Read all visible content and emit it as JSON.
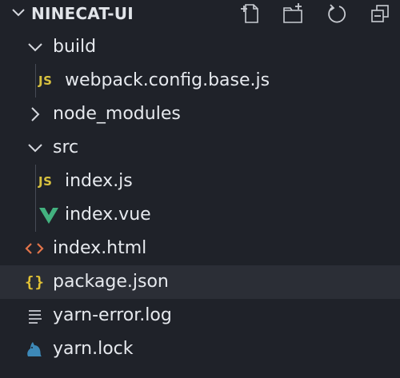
{
  "explorer": {
    "title": "NINECAT-UI",
    "actions": [
      "new-file-icon",
      "new-folder-icon",
      "refresh-icon",
      "collapse-all-icon"
    ]
  },
  "tree": {
    "build": {
      "label": "build",
      "expanded": true
    },
    "webpack_config": {
      "label": "webpack.config.base.js",
      "icon": "JS"
    },
    "node_modules": {
      "label": "node_modules",
      "expanded": false
    },
    "src": {
      "label": "src",
      "expanded": true
    },
    "index_js": {
      "label": "index.js",
      "icon": "JS"
    },
    "index_vue": {
      "label": "index.vue"
    },
    "index_html": {
      "label": "index.html"
    },
    "package_json": {
      "label": "package.json",
      "icon": "{}"
    },
    "yarn_error": {
      "label": "yarn-error.log"
    },
    "yarn_lock": {
      "label": "yarn.lock"
    }
  },
  "colors": {
    "background": "#1f2229",
    "selected_row": "#2b2e36",
    "js_yellow": "#d8c23f",
    "vue_green": "#43b17f",
    "html_orange": "#e2744a",
    "yarn_blue": "#3d89b8"
  }
}
